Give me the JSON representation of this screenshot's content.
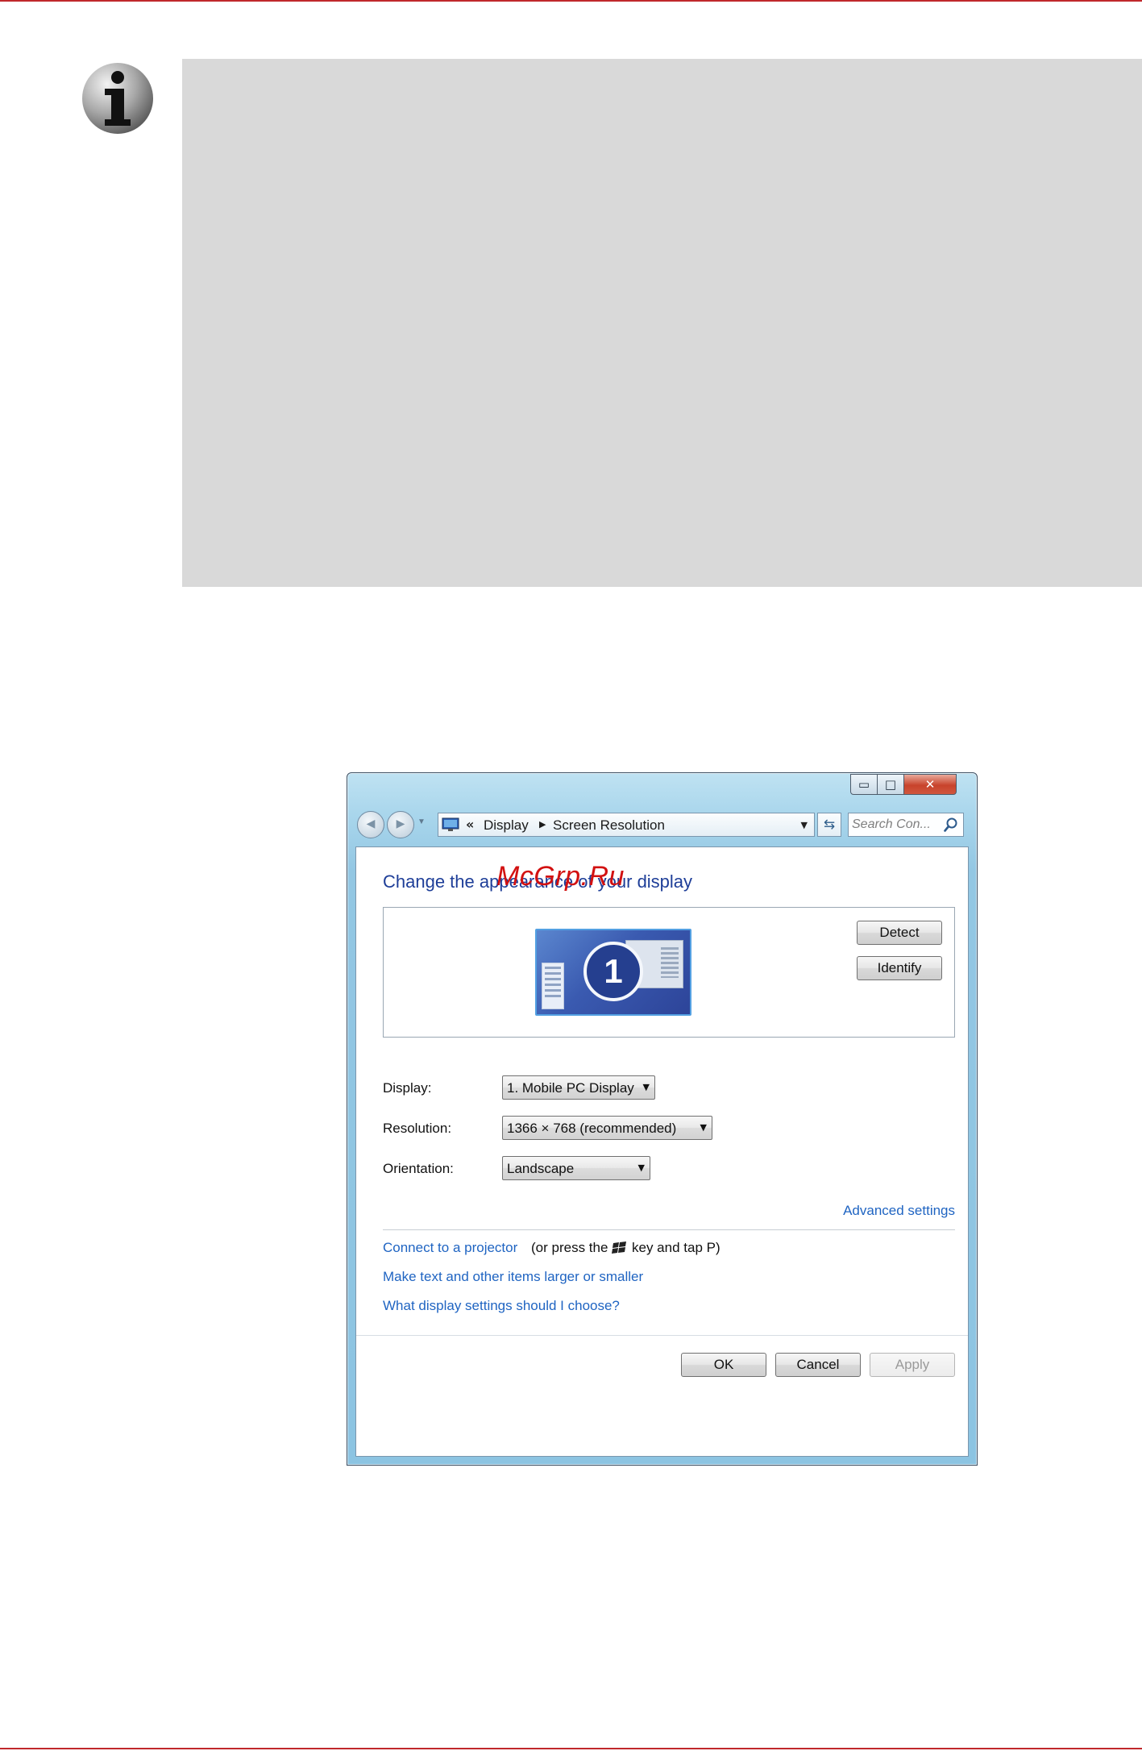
{
  "window": {
    "controls": {
      "minimize": "▭",
      "maximize": "□",
      "close": "✕"
    },
    "address": {
      "prefix": "«",
      "crumbs": [
        "Display",
        "Screen Resolution"
      ]
    },
    "search": {
      "placeholder": "Search Con..."
    }
  },
  "page": {
    "title": "Change the appearance of your display",
    "watermark": "McGrp.Ru",
    "monitor_number": "1",
    "detect_label": "Detect",
    "identify_label": "Identify",
    "display": {
      "label": "Display:",
      "value": "1. Mobile PC Display"
    },
    "resolution": {
      "label": "Resolution:",
      "value": "1366 × 768 (recommended)"
    },
    "orientation": {
      "label": "Orientation:",
      "value": "Landscape"
    },
    "advanced_settings": "Advanced settings",
    "projector": {
      "link": "Connect to a projector",
      "text_before_key": "(or press the",
      "text_after_key": "key and tap P)"
    },
    "larger_link": "Make text and other items larger or smaller",
    "help_link": "What display settings should I choose?",
    "ok": "OK",
    "cancel": "Cancel",
    "apply": "Apply"
  },
  "icons": {
    "info": "info-icon",
    "nav_back": "back-arrow-icon",
    "nav_forward": "forward-arrow-icon",
    "address": "display-control-panel-icon",
    "refresh": "refresh-icon",
    "search": "search-icon",
    "windows_key": "windows-logo-icon"
  },
  "colors": {
    "page_rule": "#c0282c",
    "note_box": "#d9d9d9",
    "title_blue": "#1e3e98",
    "link_blue": "#1f64c2",
    "watermark_red": "#d21111"
  }
}
